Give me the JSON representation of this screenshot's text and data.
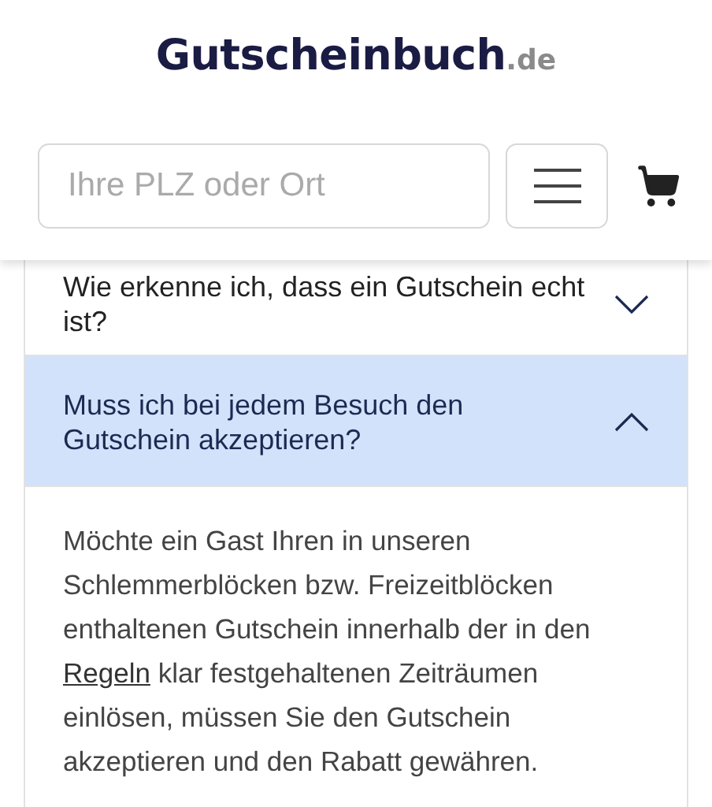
{
  "logo": {
    "name": "Gutscheinbuch",
    "suffix": ".de"
  },
  "search": {
    "placeholder": "Ihre PLZ oder Ort"
  },
  "faq": [
    {
      "question": "Wie erkenne ich, dass ein Gutschein echt ist?",
      "expanded": false
    },
    {
      "question": "Muss ich bei jedem Besuch den Gutschein akzeptieren?",
      "expanded": true,
      "answer": {
        "before": "Möchte ein Gast Ihren in unseren Schlemmerblöcken bzw. Freizeitblöcken enthaltenen Gutschein innerhalb der in den",
        "link": "Regeln",
        "after": "klar festgehaltenen Zeiträumen einlösen, müssen Sie den Gutschein akzeptieren und den Rabatt gewähren."
      }
    }
  ]
}
